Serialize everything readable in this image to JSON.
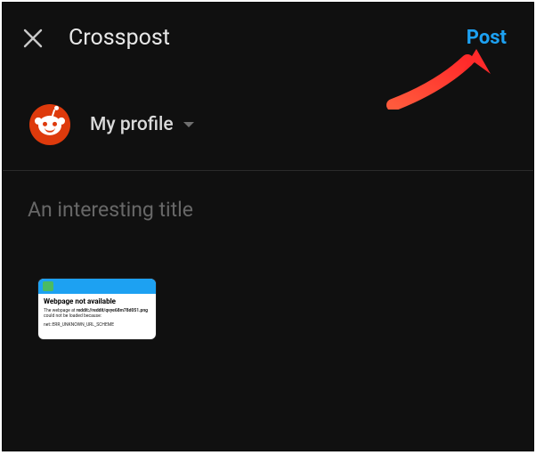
{
  "header": {
    "title": "Crosspost",
    "post_label": "Post"
  },
  "profile": {
    "label": "My profile"
  },
  "title_input": {
    "placeholder": "An interesting title"
  },
  "preview": {
    "heading": "Webpage not available",
    "line1_prefix": "The webpage at ",
    "line1_bold": "reddit://reddit/qvye68m78d051.png",
    "line1_suffix": " could not be loaded because:",
    "line2": "net::ERR_UNKNOWN_URL_SCHEME"
  },
  "colors": {
    "accent": "#1da1f2",
    "avatar_bg": "#de3a0c"
  }
}
